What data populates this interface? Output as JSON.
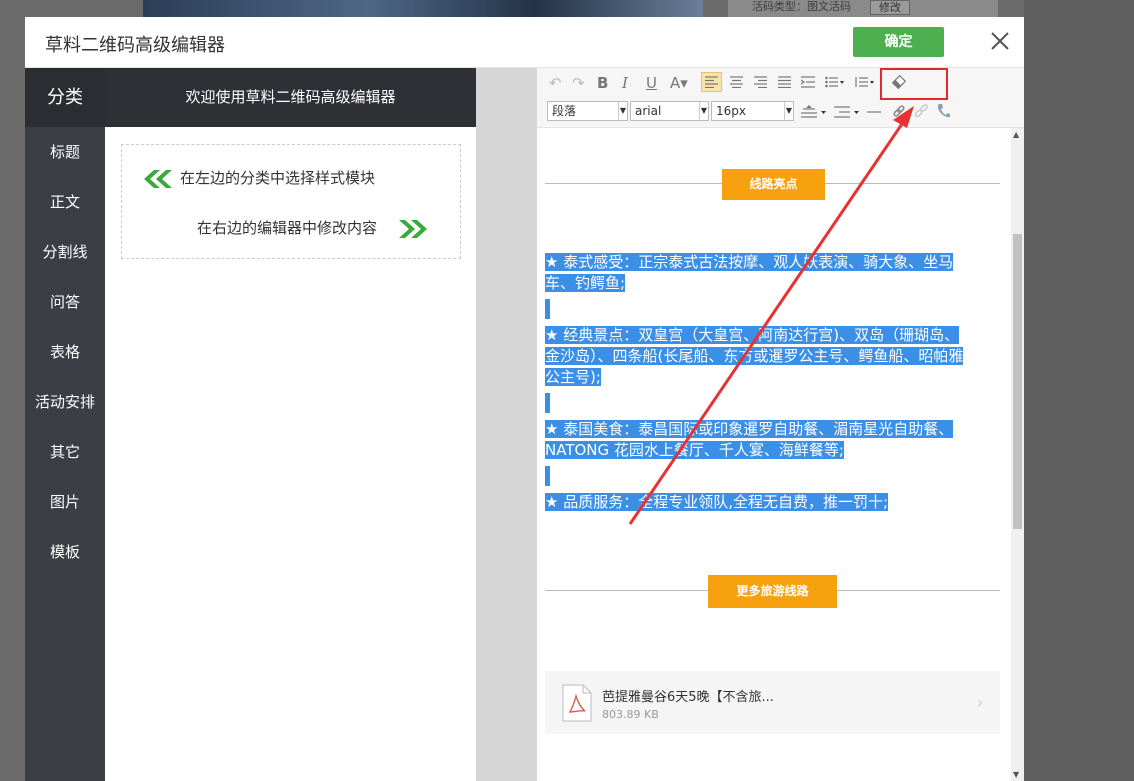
{
  "background": {
    "meta_text": "活码类型：图文活码",
    "edit_label": "修改"
  },
  "dialog": {
    "title": "草料二维码高级编辑器",
    "confirm_label": "确定"
  },
  "categories": {
    "header": "分类",
    "items": [
      "标题",
      "正文",
      "分割线",
      "问答",
      "表格",
      "活动安排",
      "其它",
      "图片",
      "模板"
    ]
  },
  "templates": {
    "header": "欢迎使用草料二维码高级编辑器",
    "tip_left": "在左边的分类中选择样式模块",
    "tip_right": "在右边的编辑器中修改内容"
  },
  "toolbar": {
    "paragraph_value": "段落",
    "font_value": "arial",
    "size_value": "16px",
    "accent_highlight": "#e02a2a"
  },
  "content": {
    "section1": "线路亮点",
    "lines": [
      "★ 泰式感受：正宗泰式古法按摩、观人妖表演、骑大象、坐马",
      "车、钓鳄鱼;",
      "★ 经典景点：双皇宫（大皇宫、阿南达行宫)、双岛（珊瑚岛、",
      "金沙岛）、四条船(长尾船、东方或暹罗公主号、鳄鱼船、昭帕雅",
      "公主号);",
      "★ 泰国美食：泰昌国际或印象暹罗自助餐、湄南星光自助餐、",
      "NATONG 花园水上餐厅、千人宴、海鲜餐等;",
      "★ 品质服务：全程专业领队,全程无自费，推一罚十;"
    ],
    "section2": "更多旅游线路",
    "file_name": "芭提雅曼谷6天5晚【不含旅...",
    "file_size": "803.89 KB",
    "badge_color": "#f7a10f",
    "selection_color": "#3c8fe6"
  }
}
